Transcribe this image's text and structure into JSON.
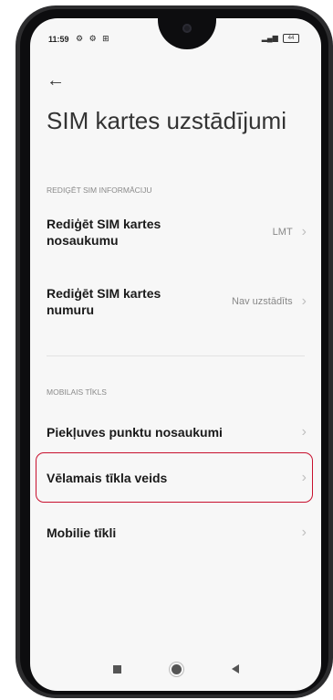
{
  "status": {
    "time": "11:59",
    "left_icons": "⚙ ⚙ ⊞",
    "signal": "📶",
    "battery": "44"
  },
  "page": {
    "back_icon": "←",
    "title": "SIM kartes uzstādījumi"
  },
  "sections": {
    "sim_info": {
      "label": "REDIĢĒT SIM INFORMĀCIJU",
      "items": [
        {
          "label": "Rediģēt SIM kartes nosaukumu",
          "value": "LMT"
        },
        {
          "label": "Rediģēt SIM kartes numuru",
          "value": "Nav uzstādīts"
        }
      ]
    },
    "mobile_network": {
      "label": "MOBILAIS TĪKLS",
      "items": [
        {
          "label": "Piekļuves punktu nosaukumi",
          "value": ""
        },
        {
          "label": "Vēlamais tīkla veids",
          "value": "",
          "highlighted": true
        },
        {
          "label": "Mobilie tīkli",
          "value": ""
        }
      ]
    }
  },
  "chevron": "›",
  "colors": {
    "highlight": "#c8102e",
    "background": "#f7f7f7"
  }
}
